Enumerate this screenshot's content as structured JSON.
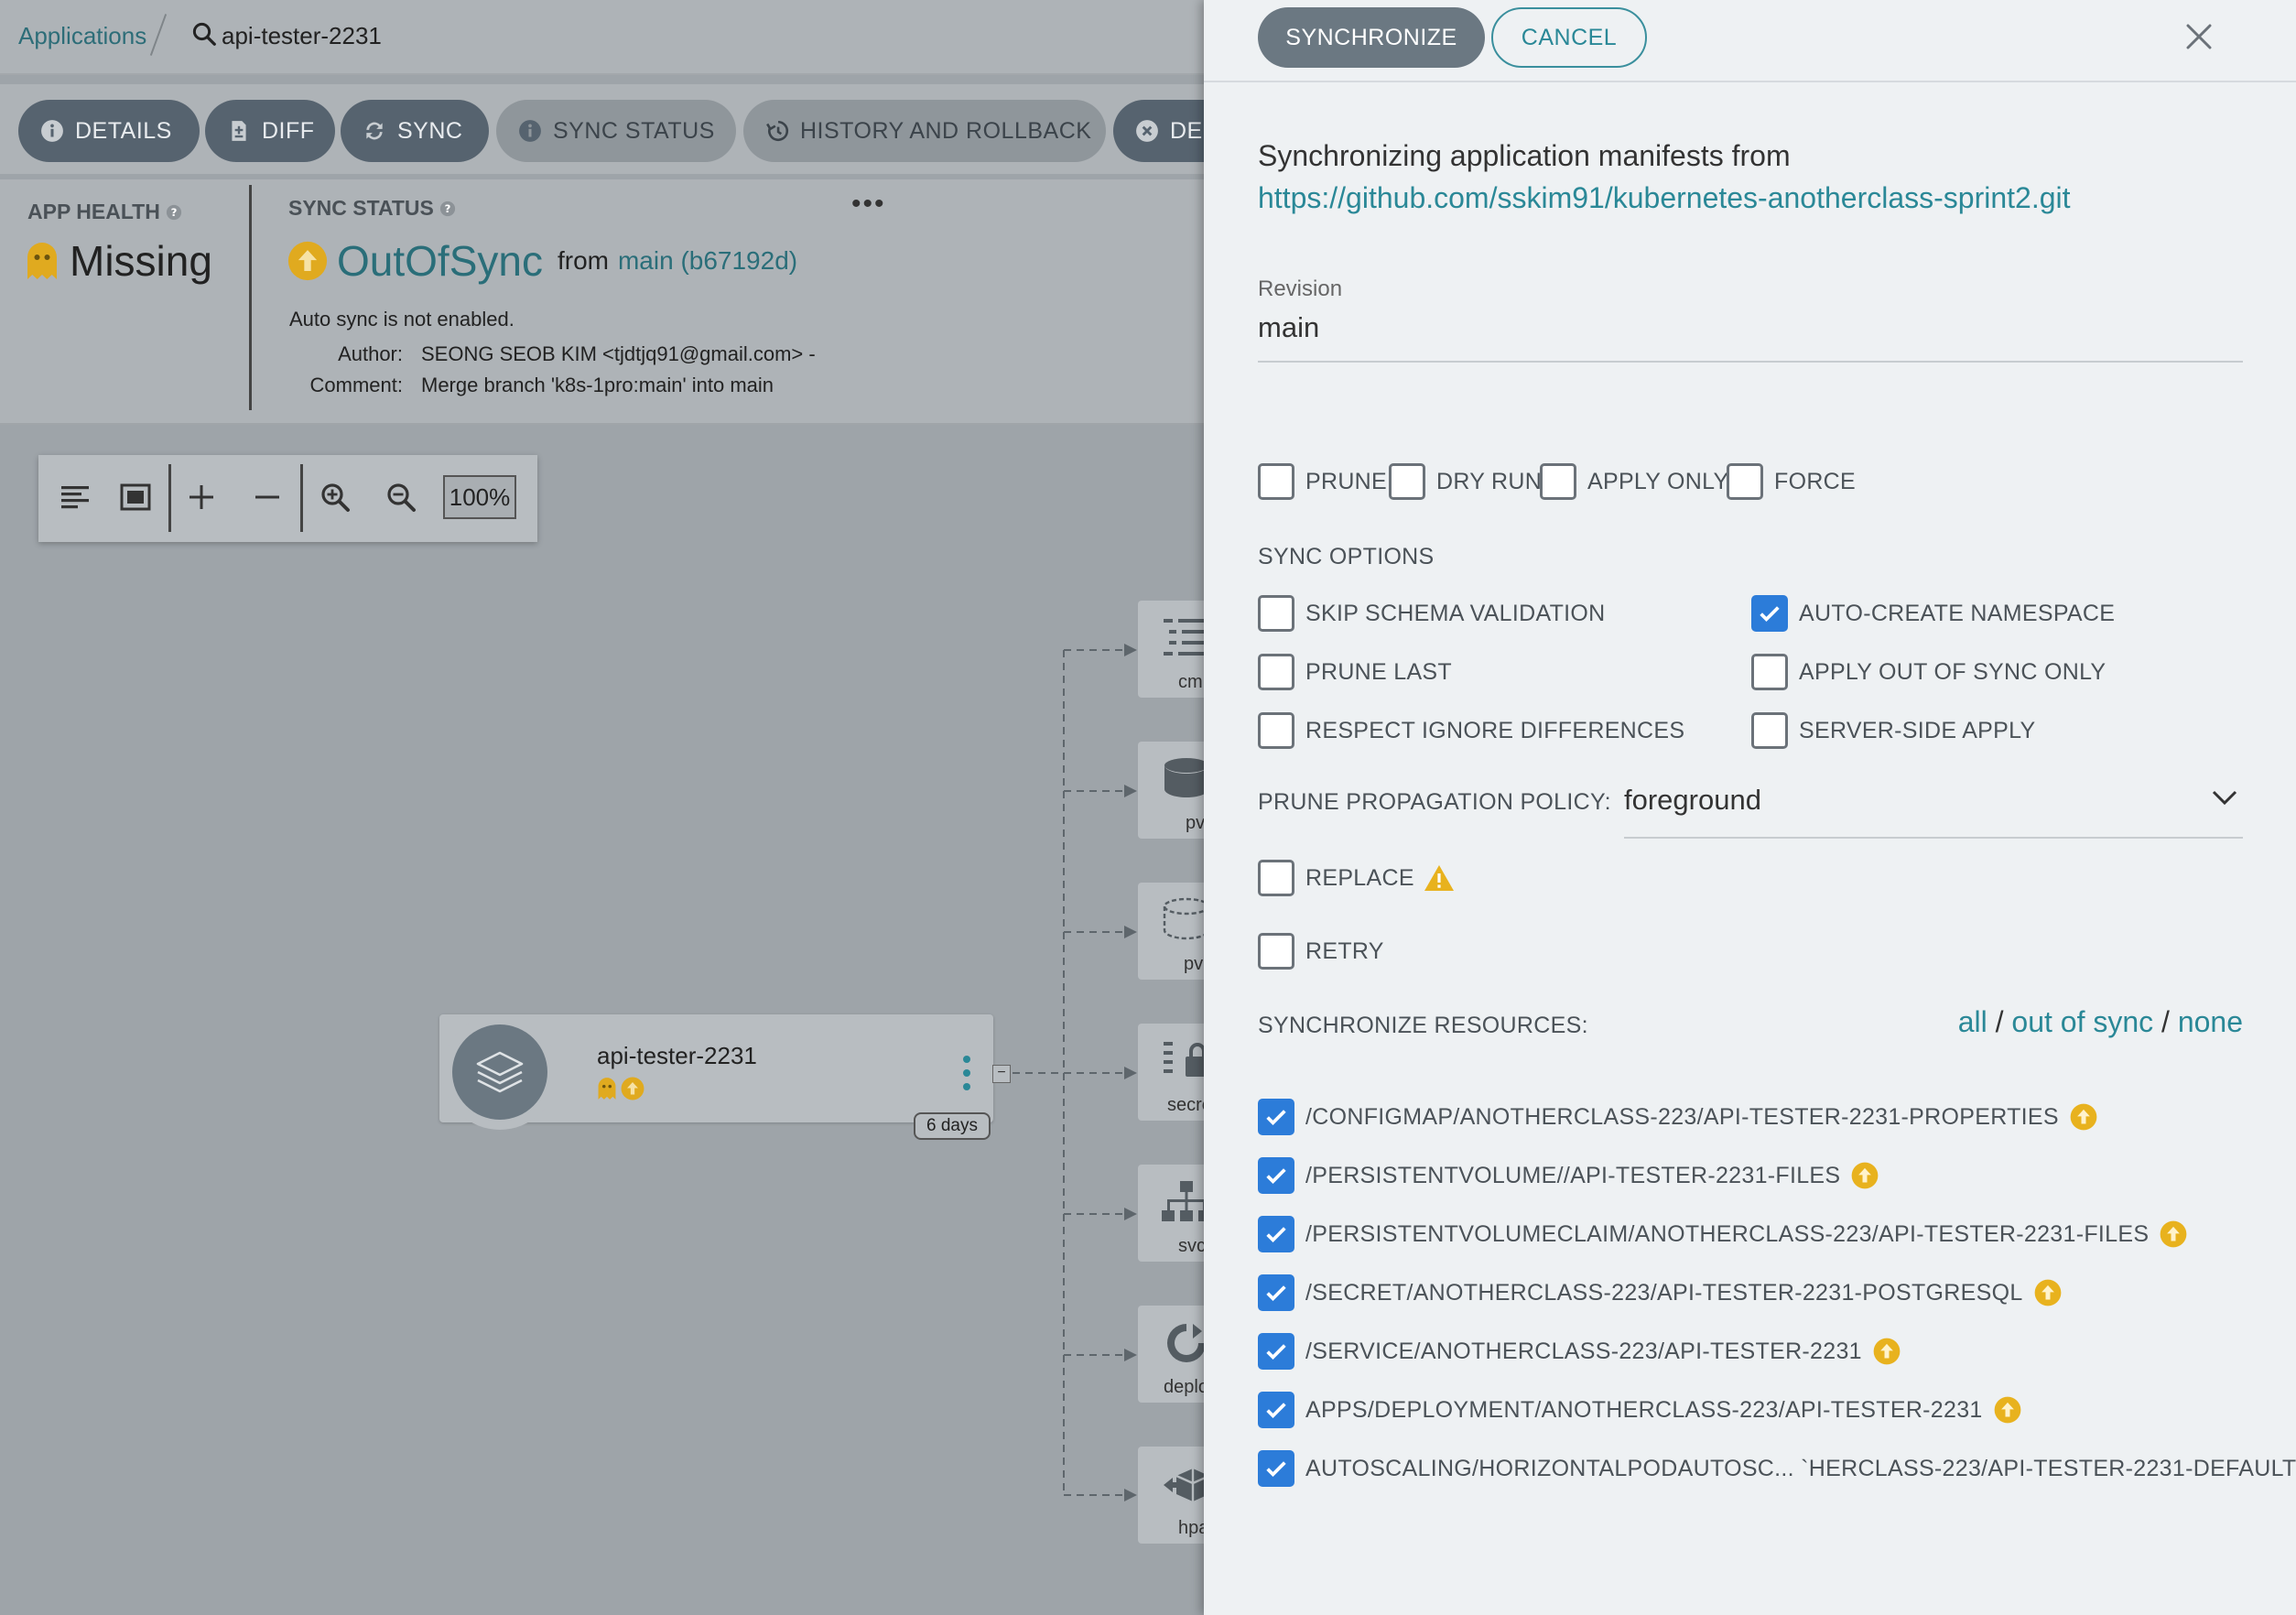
{
  "breadcrumb": {
    "root": "Applications",
    "app": "api-tester-2231"
  },
  "actions": [
    {
      "label": "DETAILS",
      "icon": "info-icon"
    },
    {
      "label": "DIFF",
      "icon": "file-diff-icon"
    },
    {
      "label": "SYNC",
      "icon": "sync-icon"
    },
    {
      "label": "SYNC STATUS",
      "icon": "info-icon"
    },
    {
      "label": "HISTORY AND ROLLBACK",
      "icon": "history-icon"
    },
    {
      "label": "DELETE",
      "icon": "close-circle-icon"
    }
  ],
  "status": {
    "health_label": "APP HEALTH",
    "health_value": "Missing",
    "sync_label": "SYNC STATUS",
    "sync_value": "OutOfSync",
    "from": "from",
    "revision": "main (b67192d)",
    "auto_sync": "Auto sync is not enabled.",
    "author_label": "Author:",
    "author_value": "SEONG SEOB KIM <tjdtjq91@gmail.com> -",
    "comment_label": "Comment:",
    "comment_value": "Merge branch 'k8s-1pro:main' into main"
  },
  "toolbar": {
    "zoom": "100%"
  },
  "graph": {
    "app_node": {
      "title": "api-tester-2231",
      "age": "6 days"
    },
    "resource_labels": [
      "cm",
      "pv",
      "pvc",
      "secret",
      "svc",
      "deploy",
      "hpa"
    ]
  },
  "panel": {
    "synchronize_label": "SYNCHRONIZE",
    "cancel_label": "CANCEL",
    "intro": "Synchronizing application manifests from",
    "repo_url": "https://github.com/sskim91/kubernetes-anotherclass-sprint2.git",
    "revision_label": "Revision",
    "revision_value": "main",
    "top_options": [
      {
        "label": "PRUNE",
        "checked": false
      },
      {
        "label": "DRY RUN",
        "checked": false
      },
      {
        "label": "APPLY ONLY",
        "checked": false
      },
      {
        "label": "FORCE",
        "checked": false
      }
    ],
    "sync_options_title": "SYNC OPTIONS",
    "sync_options": [
      {
        "label": "SKIP SCHEMA VALIDATION",
        "checked": false
      },
      {
        "label": "AUTO-CREATE NAMESPACE",
        "checked": true
      },
      {
        "label": "PRUNE LAST",
        "checked": false
      },
      {
        "label": "APPLY OUT OF SYNC ONLY",
        "checked": false
      },
      {
        "label": "RESPECT IGNORE DIFFERENCES",
        "checked": false
      },
      {
        "label": "SERVER-SIDE APPLY",
        "checked": false
      }
    ],
    "prune_policy_label": "PRUNE PROPAGATION POLICY:",
    "prune_policy_value": "foreground",
    "replace_label": "REPLACE",
    "retry_label": "RETRY",
    "sync_resources_label": "SYNCHRONIZE RESOURCES:",
    "select_links": {
      "all": "all",
      "out_of_sync": "out of sync",
      "none": "none",
      "sep": "/"
    },
    "resources": [
      {
        "label": "/CONFIGMAP/ANOTHERCLASS-223/API-TESTER-2231-PROPERTIES",
        "checked": true
      },
      {
        "label": "/PERSISTENTVOLUME//API-TESTER-2231-FILES",
        "checked": true
      },
      {
        "label": "/PERSISTENTVOLUMECLAIM/ANOTHERCLASS-223/API-TESTER-2231-FILES",
        "checked": true
      },
      {
        "label": "/SECRET/ANOTHERCLASS-223/API-TESTER-2231-POSTGRESQL",
        "checked": true
      },
      {
        "label": "/SERVICE/ANOTHERCLASS-223/API-TESTER-2231",
        "checked": true
      },
      {
        "label": "APPS/DEPLOYMENT/ANOTHERCLASS-223/API-TESTER-2231",
        "checked": true
      },
      {
        "label": "AUTOSCALING/HORIZONTALPODAUTOSC... `HERCLASS-223/API-TESTER-2231-DEFAULT",
        "checked": true
      }
    ]
  },
  "colors": {
    "accent": "#2a8897",
    "check": "#2c7cd9",
    "warning": "#e8b21e",
    "dim": "#9ea4a9"
  }
}
